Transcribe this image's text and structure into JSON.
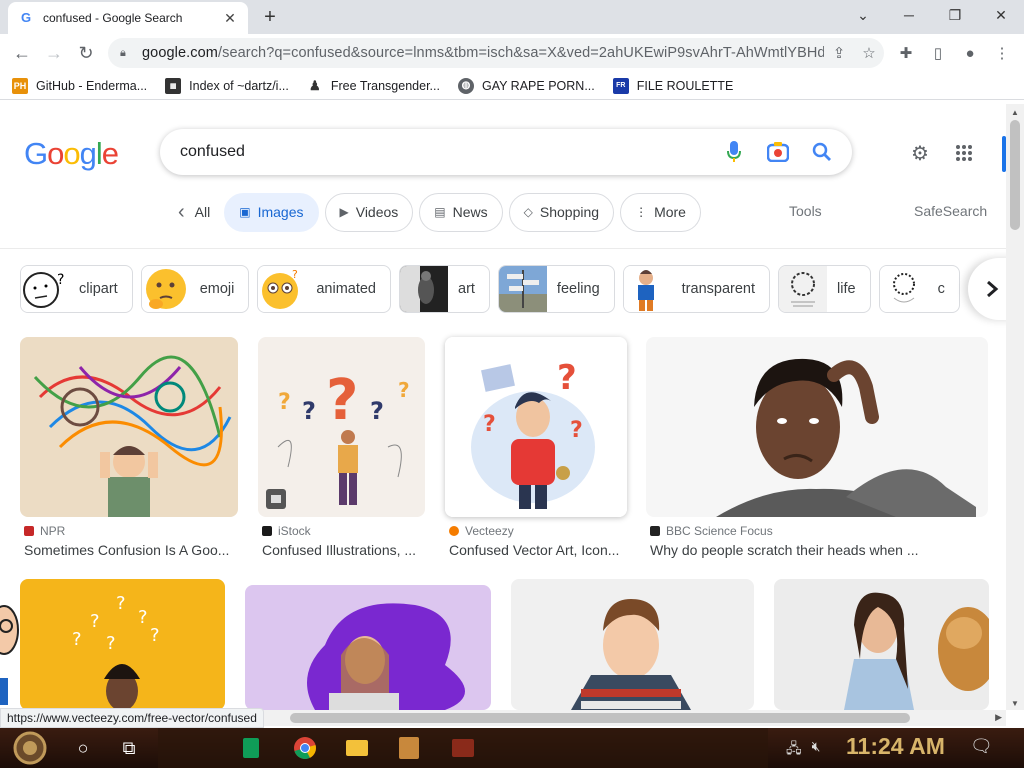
{
  "browser": {
    "tab_title": "confused - Google Search",
    "tab_favicon": "G",
    "new_tab": "+",
    "url_host": "google.com",
    "url_rest": "/search?q=confused&source=lnms&tbm=isch&sa=X&ved=2ahUKEwiP9svAhrT-AhWmtlYBHd...",
    "bookmarks": [
      {
        "icon": "PH",
        "label": "GitHub - Enderma..."
      },
      {
        "icon": "idx",
        "label": "Index of ~dartz/i..."
      },
      {
        "icon": "t",
        "label": "Free Transgender..."
      },
      {
        "icon": "globe",
        "label": "GAY RAPE PORN..."
      },
      {
        "icon": "FR",
        "label": "FILE ROULETTE"
      }
    ]
  },
  "google": {
    "query": "confused",
    "tabs": [
      {
        "label": "All",
        "icon": "‹"
      },
      {
        "label": "Images",
        "icon": "▣"
      },
      {
        "label": "Videos",
        "icon": "▶"
      },
      {
        "label": "News",
        "icon": "▤"
      },
      {
        "label": "Shopping",
        "icon": "◇"
      },
      {
        "label": "More",
        "icon": "⋮"
      }
    ],
    "tools": "Tools",
    "safesearch": "SafeSearch",
    "chips": [
      "clipart",
      "emoji",
      "animated",
      "art",
      "feeling",
      "transparent",
      "life",
      "c"
    ],
    "results": [
      {
        "source": "NPR",
        "title": "Sometimes Confusion Is A Goo..."
      },
      {
        "source": "iStock",
        "title": "Confused Illustrations, ..."
      },
      {
        "source": "Vecteezy",
        "title": "Confused Vector Art, Icon..."
      },
      {
        "source": "BBC Science Focus",
        "title": "Why do people scratch their heads when ..."
      }
    ]
  },
  "status_url": "https://www.vecteezy.com/free-vector/confused",
  "taskbar": {
    "clock": "11:24 AM"
  }
}
